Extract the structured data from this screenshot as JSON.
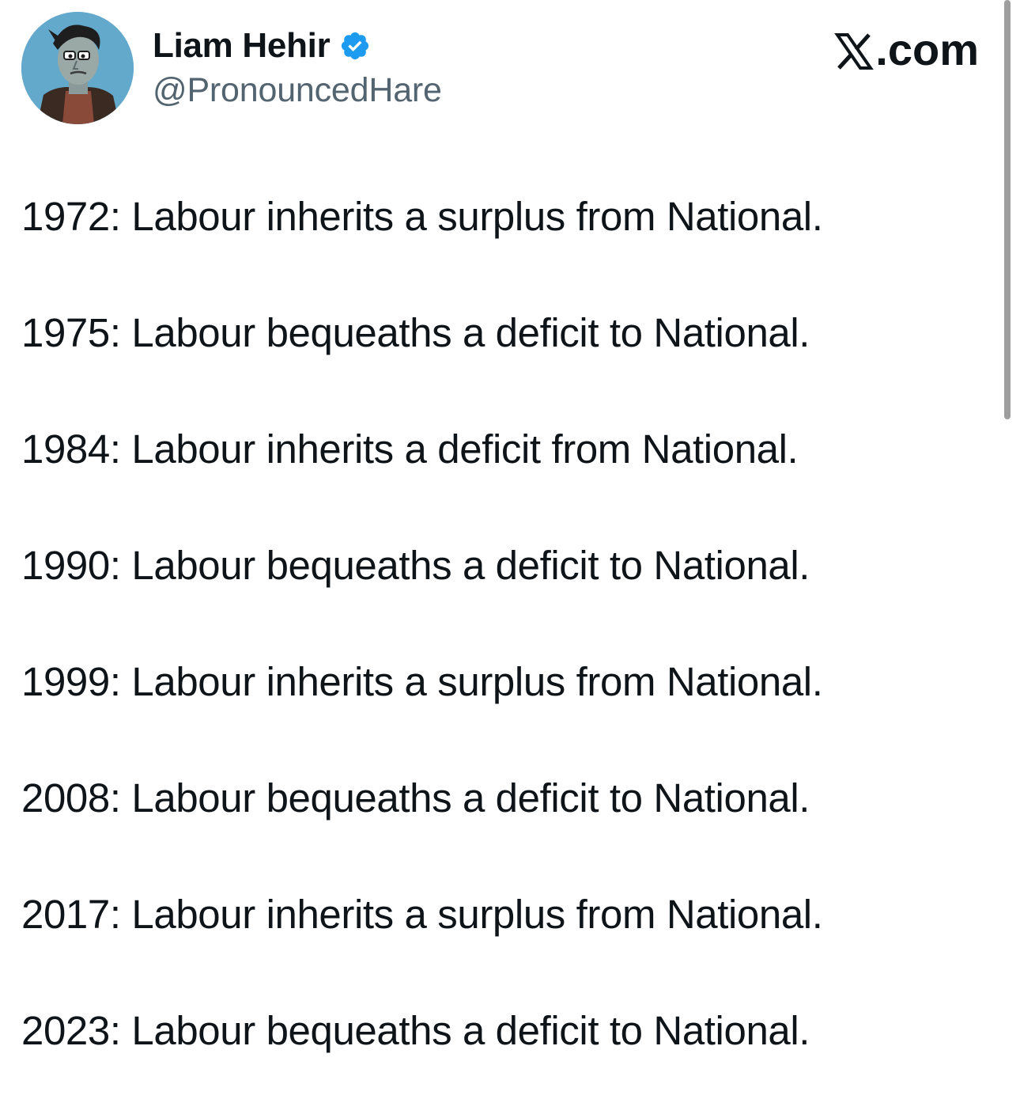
{
  "author": {
    "name": "Liam Hehir",
    "handle": "@PronouncedHare",
    "verified": true
  },
  "site": {
    "watermark": ".com",
    "logo_icon": "x-logo-icon"
  },
  "tweet": {
    "lines": [
      "1972: Labour inherits a surplus from National.",
      "1975: Labour bequeaths a deficit to National.",
      "1984: Labour inherits a deficit from National.",
      "1990: Labour bequeaths a deficit to National.",
      "1999: Labour inherits a surplus from National.",
      "2008: Labour bequeaths a deficit to National.",
      "2017: Labour inherits a surplus from National.",
      "2023: Labour bequeaths a deficit to National."
    ]
  },
  "colors": {
    "text": "#0f1419",
    "handle": "#536471",
    "verified": "#1d9bf0"
  }
}
